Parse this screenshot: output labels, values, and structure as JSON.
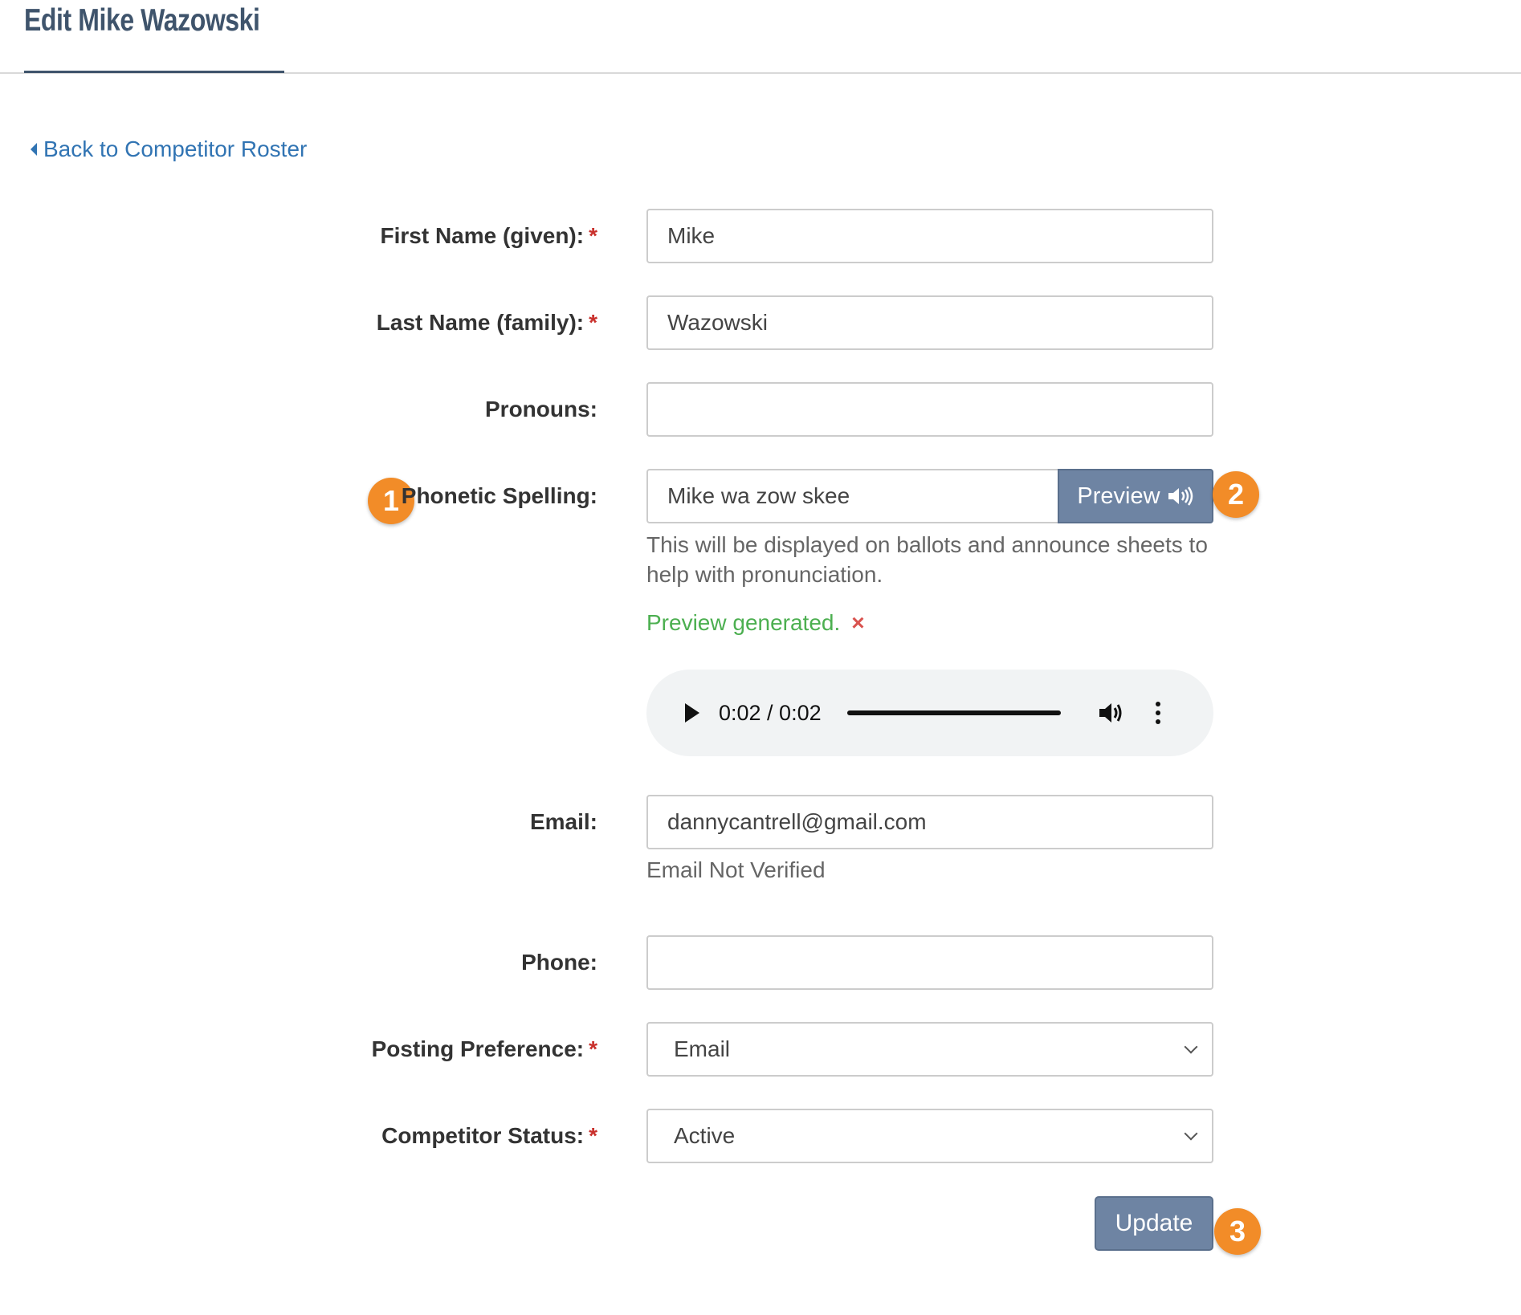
{
  "header": {
    "title": "Edit Mike Wazowski"
  },
  "nav": {
    "back_label": "Back to Competitor Roster"
  },
  "form": {
    "required_mark": "*",
    "first_name": {
      "label": "First Name (given):",
      "value": "Mike"
    },
    "last_name": {
      "label": "Last Name (family):",
      "value": "Wazowski"
    },
    "pronouns": {
      "label": "Pronouns:",
      "value": ""
    },
    "phonetic": {
      "label": "Phonetic Spelling:",
      "value": "Mike wa zow skee",
      "preview_label": "Preview",
      "help": "This will be displayed on ballots and announce sheets to help with pronunciation.",
      "status": "Preview generated.",
      "dismiss": "×"
    },
    "audio": {
      "time": "0:02 / 0:02",
      "progress_fraction": 1.0
    },
    "email": {
      "label": "Email:",
      "value": "dannycantrell@gmail.com",
      "status": "Email Not Verified"
    },
    "phone": {
      "label": "Phone:",
      "value": ""
    },
    "posting_preference": {
      "label": "Posting Preference:",
      "selected": "Email"
    },
    "competitor_status": {
      "label": "Competitor Status:",
      "selected": "Active"
    },
    "update_label": "Update"
  },
  "annotations": {
    "badge1": "1",
    "badge2": "2",
    "badge3": "3",
    "color": "#f28c28"
  },
  "colors": {
    "accent": "#6e84a3",
    "link": "#3174b3",
    "success": "#4caf50",
    "required": "#c9302c"
  }
}
